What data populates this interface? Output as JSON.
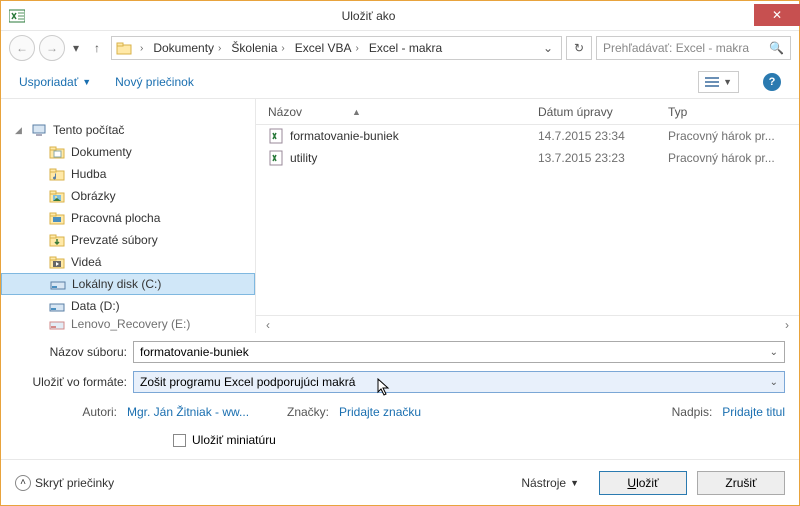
{
  "title": "Uložiť ako",
  "nav": {
    "crumbs": [
      "Dokumenty",
      "Školenia",
      "Excel VBA",
      "Excel - makra"
    ]
  },
  "search": {
    "placeholder": "Prehľadávať: Excel - makra"
  },
  "toolbar": {
    "organize": "Usporiadať",
    "newfolder": "Nový priečinok"
  },
  "tree": {
    "root": "Tento počítač",
    "items": [
      "Dokumenty",
      "Hudba",
      "Obrázky",
      "Pracovná plocha",
      "Prevzaté súbory",
      "Videá",
      "Lokálny disk (C:)",
      "Data (D:)",
      "Lenovo_Recovery (E:)"
    ],
    "selected_index": 6
  },
  "columns": {
    "name": "Názov",
    "date": "Dátum úpravy",
    "type": "Typ"
  },
  "files": [
    {
      "name": "formatovanie-buniek",
      "date": "14.7.2015 23:34",
      "type": "Pracovný hárok pr..."
    },
    {
      "name": "utility",
      "date": "13.7.2015 23:23",
      "type": "Pracovný hárok pr..."
    }
  ],
  "form": {
    "filename_label": "Názov súboru:",
    "filename_value": "formatovanie-buniek",
    "format_label": "Uložiť vo formáte:",
    "format_value": "Zošit programu Excel podporujúci makrá",
    "authors_label": "Autori:",
    "authors_value": "Mgr. Ján Žitniak - ww...",
    "tags_label": "Značky:",
    "tags_value": "Pridajte značku",
    "title_label": "Nadpis:",
    "title_value": "Pridajte titul",
    "thumb_label": "Uložiť miniatúru"
  },
  "footer": {
    "hide": "Skryť priečinky",
    "tools": "Nástroje",
    "save": "Uložiť",
    "cancel": "Zrušiť"
  }
}
